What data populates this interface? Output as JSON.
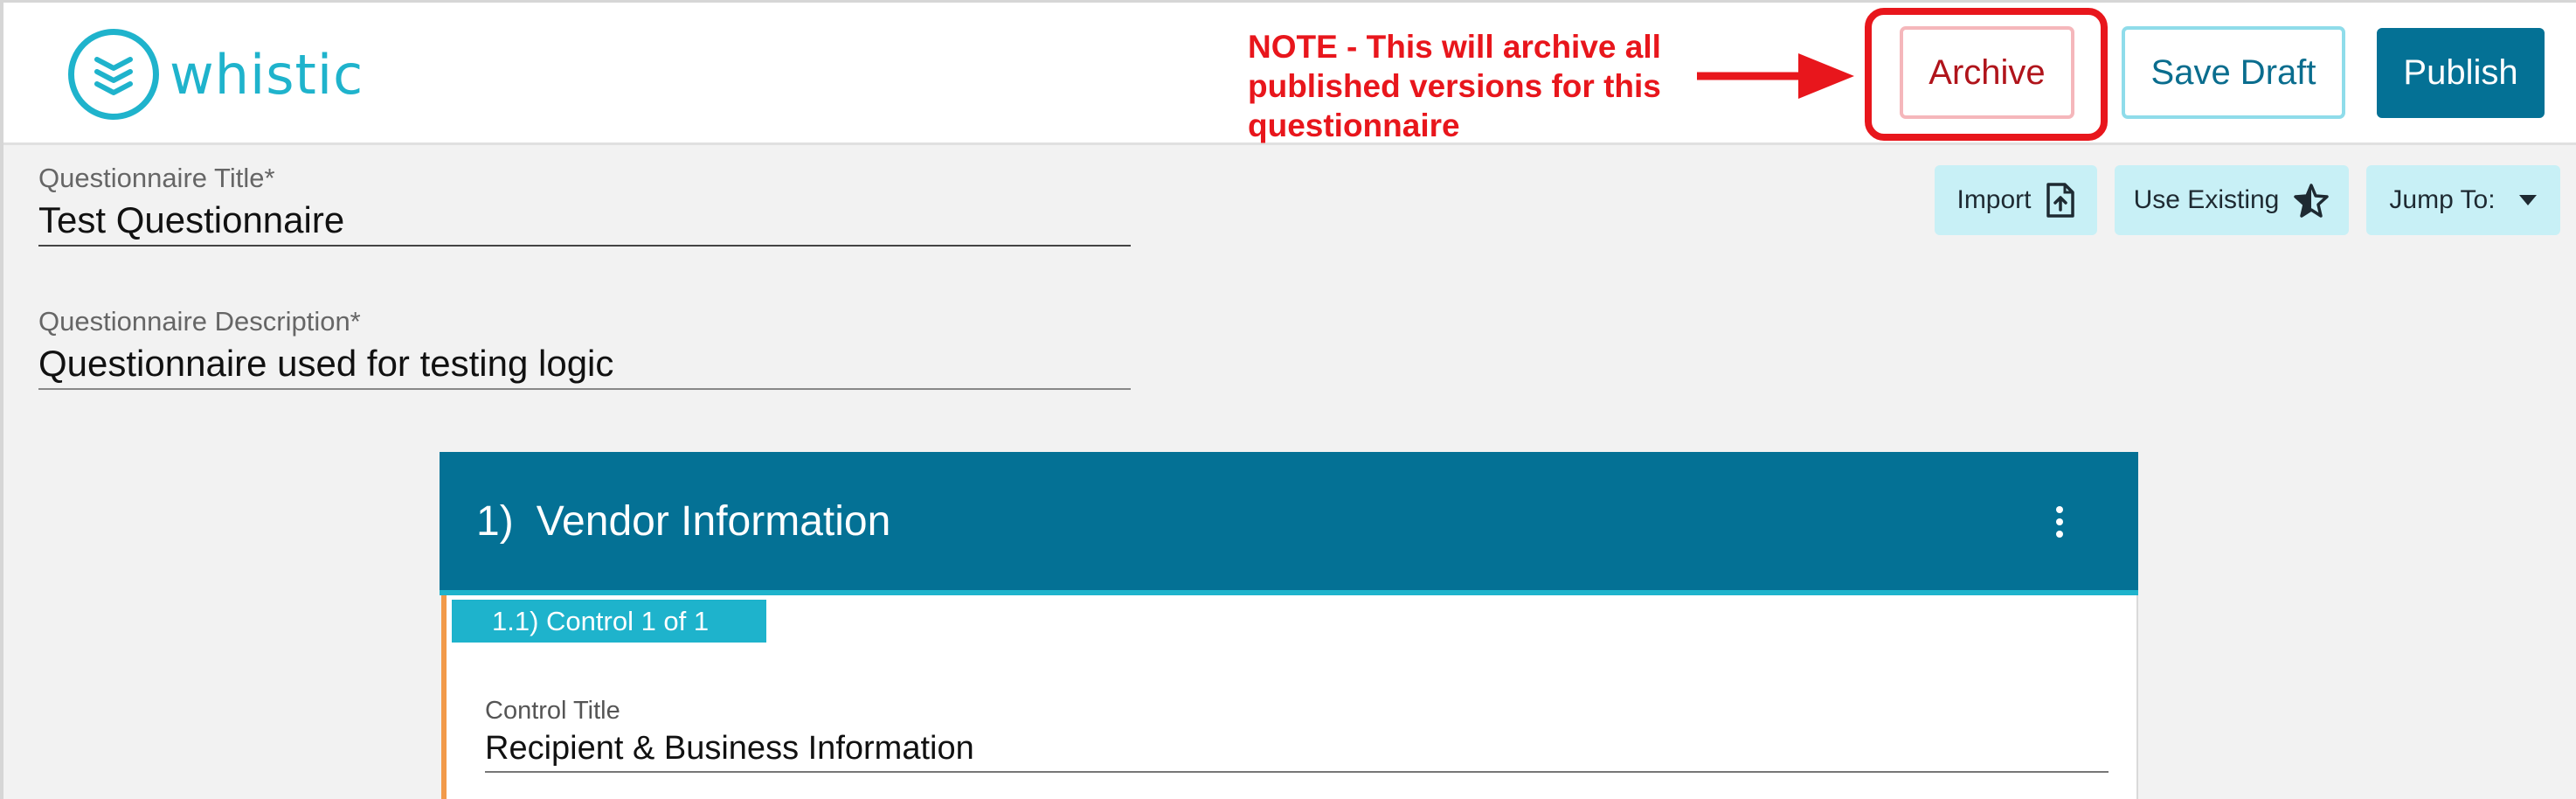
{
  "app": {
    "logo_text": "whistic",
    "logo_icon": "whistic-logo-icon"
  },
  "annotation": {
    "note": "NOTE - This will archive all published versions for this questionnaire",
    "color": "#e8161c"
  },
  "toolbar": {
    "archive_label": "Archive",
    "save_draft_label": "Save Draft",
    "publish_label": "Publish"
  },
  "form": {
    "title_label": "Questionnaire Title*",
    "title_value": "Test Questionnaire",
    "description_label": "Questionnaire Description*",
    "description_value": "Questionnaire used for testing logic"
  },
  "tools": {
    "import_label": "Import",
    "import_icon": "file-upload-icon",
    "use_existing_label": "Use Existing",
    "use_existing_icon": "star-icon",
    "jump_to_label": "Jump To:",
    "jump_to_icon": "caret-down-icon"
  },
  "section": {
    "number": "1)",
    "title": "Vendor Information",
    "menu_icon": "kebab-menu-icon",
    "control": {
      "tag": "1.1) Control 1 of 1",
      "title_label": "Control Title",
      "title_value": "Recipient & Business Information"
    }
  },
  "colors": {
    "brand_teal": "#1fb3cc",
    "primary_blue": "#047195",
    "accent_orange": "#f29a4a",
    "tool_bg": "#c8f0f6"
  }
}
